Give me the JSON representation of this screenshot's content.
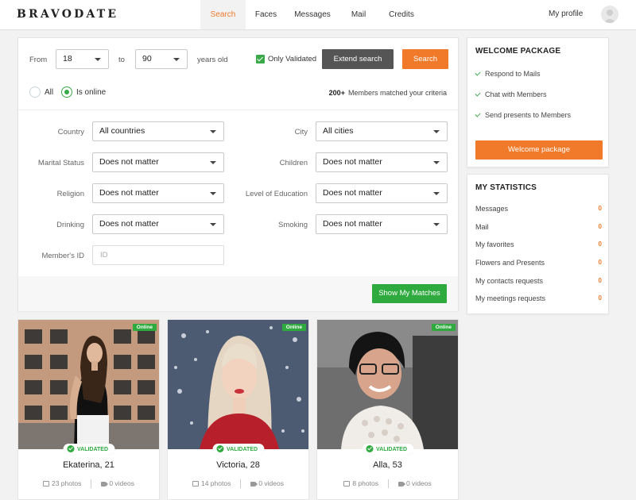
{
  "header": {
    "logo": "BRAVODATE",
    "nav": [
      {
        "label": "Search",
        "active": true
      },
      {
        "label": "Faces",
        "active": false
      },
      {
        "label": "Messages",
        "active": false
      },
      {
        "label": "Mail",
        "active": false
      },
      {
        "label": "Credits",
        "active": false
      }
    ],
    "profile_label": "My profile"
  },
  "search": {
    "from_label": "From",
    "from_value": "18",
    "to_label": "to",
    "to_value": "90",
    "years_label": "years old",
    "only_validated_label": "Only Validated",
    "only_validated_checked": true,
    "extend_label": "Extend search",
    "search_label": "Search",
    "radio_all": "All",
    "radio_online": "Is online",
    "match_count": "200+",
    "match_text": "Members matched your criteria"
  },
  "filters": {
    "country": {
      "label": "Country",
      "value": "All countries"
    },
    "city": {
      "label": "City",
      "value": "All cities"
    },
    "marital": {
      "label": "Marital Status",
      "value": "Does not matter"
    },
    "children": {
      "label": "Children",
      "value": "Does not matter"
    },
    "religion": {
      "label": "Religion",
      "value": "Does not matter"
    },
    "education": {
      "label": "Level of Education",
      "value": "Does not matter"
    },
    "drinking": {
      "label": "Drinking",
      "value": "Does not matter"
    },
    "smoking": {
      "label": "Smoking",
      "value": "Does not matter"
    },
    "member_id": {
      "label": "Member's ID",
      "placeholder": "ID"
    },
    "show_matches": "Show My Matches"
  },
  "welcome": {
    "title": "WELCOME PACKAGE",
    "items": [
      "Respond to Mails",
      "Chat with Members",
      "Send presents to Members"
    ],
    "button": "Welcome package"
  },
  "stats": {
    "title": "MY STATISTICS",
    "rows": [
      {
        "label": "Messages",
        "value": "0"
      },
      {
        "label": "Mail",
        "value": "0"
      },
      {
        "label": "My favorites",
        "value": "0"
      },
      {
        "label": "Flowers and Presents",
        "value": "0"
      },
      {
        "label": "My contacts requests",
        "value": "0"
      },
      {
        "label": "My meetings requests",
        "value": "0"
      }
    ]
  },
  "profiles": [
    {
      "name": "Ekaterina, 21",
      "photos": "23 photos",
      "videos": "0 videos",
      "online": "Online",
      "validated": "VALIDATED"
    },
    {
      "name": "Victoria, 28",
      "photos": "14 photos",
      "videos": "0 videos",
      "online": "Online",
      "validated": "VALIDATED"
    },
    {
      "name": "Alla, 53",
      "photos": "8 photos",
      "videos": "0 videos",
      "online": "Online",
      "validated": "VALIDATED"
    }
  ],
  "colors": {
    "accent_orange": "#f07a2a",
    "accent_green": "#2eaa3f",
    "dark_button": "#555555"
  }
}
